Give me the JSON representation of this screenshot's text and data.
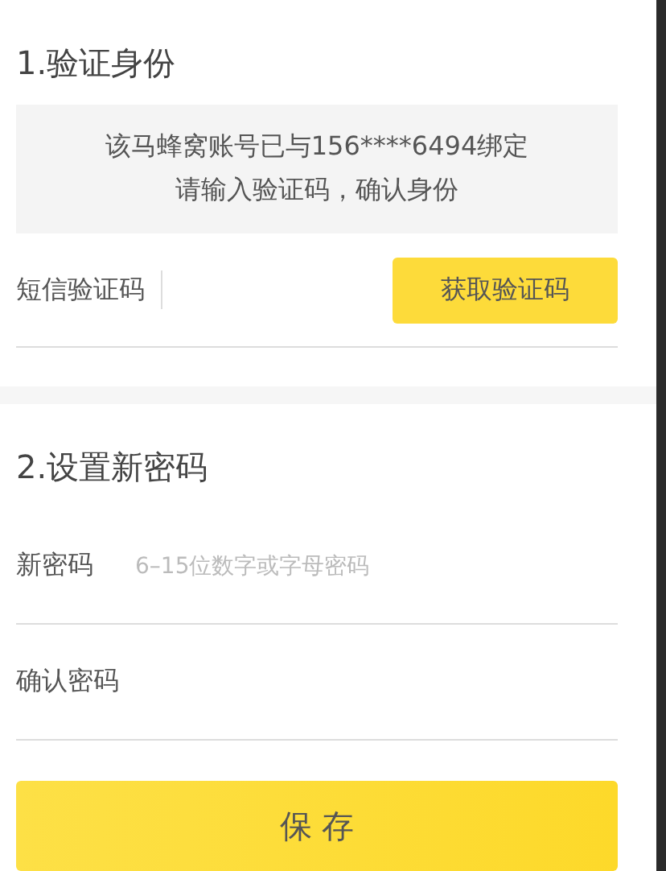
{
  "verify_section": {
    "title": "1.验证身份",
    "notice_lines": [
      "该马蜂窝账号已与156****6494绑定",
      "请输入验证码，确认身份"
    ],
    "sms_field": {
      "label": "短信验证码"
    },
    "get_code_button": "获取验证码"
  },
  "password_section": {
    "title": "2.设置新密码",
    "fields": [
      {
        "label": "新密码",
        "placeholder": "6–15位数字或字母密码"
      },
      {
        "label": "确认密码"
      }
    ]
  },
  "save_button": "保 存"
}
